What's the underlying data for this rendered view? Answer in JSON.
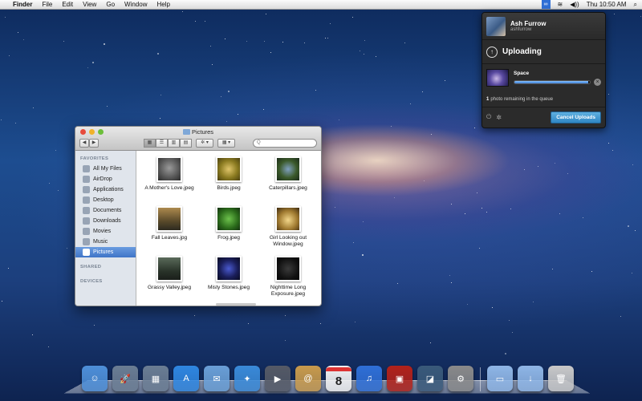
{
  "menubar": {
    "apple": "",
    "app_menus": [
      "Finder",
      "File",
      "Edit",
      "View",
      "Go",
      "Window",
      "Help"
    ],
    "extension_icon": "∞",
    "wifi_icon": "wifi-icon",
    "volume_icon": "volume-icon",
    "clock": "Thu 10:50 AM",
    "spotlight_icon": "magnifier-icon"
  },
  "upload_popover": {
    "user_name": "Ash Furrow",
    "user_handle": "ashfurrow",
    "status_title": "Uploading",
    "item_name": "Space",
    "progress_fraction": 0.98,
    "queue_count": "1",
    "queue_text": "photo remaining in the queue",
    "cancel_label": "Cancel Uploads"
  },
  "finder": {
    "title": "Pictures",
    "nav": [
      "◀",
      "▶"
    ],
    "view_buttons": [
      "▦",
      "☰",
      "▥",
      "▤"
    ],
    "action_label": "✲ ▾",
    "arrange_label": "▦ ▾",
    "search_placeholder": "Q",
    "sidebar": {
      "favorites_header": "FAVORITES",
      "favorites": [
        "All My Files",
        "AirDrop",
        "Applications",
        "Desktop",
        "Documents",
        "Downloads",
        "Movies",
        "Music",
        "Pictures"
      ],
      "selected_index": 8,
      "shared_header": "SHARED",
      "devices_header": "DEVICES"
    },
    "files": [
      {
        "name": "A Mother's Love.jpeg"
      },
      {
        "name": "Birds.jpeg"
      },
      {
        "name": "Caterpillars.jpeg"
      },
      {
        "name": "Fall Leaves.jpg"
      },
      {
        "name": "Frog.jpeg"
      },
      {
        "name": "Girl Looking out Window.jpeg"
      },
      {
        "name": "Grassy Valley.jpeg"
      },
      {
        "name": "Misty Stones.jpeg"
      },
      {
        "name": "Nighttime Long Exposure.jpeg"
      }
    ]
  },
  "dock": {
    "calendar_date": "8",
    "colors": {
      "finder": "#4e8fd8",
      "launchpad": "#6b7d93",
      "appstore": "#2f86e0",
      "mail": "#6a9fd6",
      "safari": "#3a8ad8",
      "facetime": "#555a66",
      "addressbook": "#c89a4c",
      "calendar": "#f2f2f2",
      "itunes": "#2f6fd6",
      "photobooth": "#b2221a",
      "iphoto": "#3a5a7a",
      "prefs": "#8a8a8a",
      "folder": "#8fb6e6",
      "trash": "#c8c8c8"
    }
  }
}
